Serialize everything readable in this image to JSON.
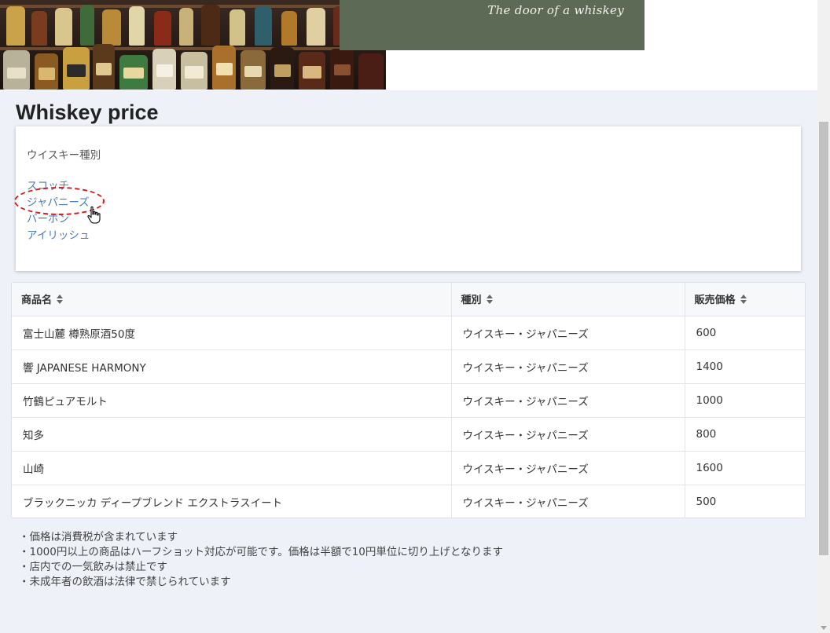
{
  "header": {
    "tagline": "The door of a whiskey"
  },
  "page_title": "Whiskey price",
  "category_card": {
    "label": "ウイスキー種別",
    "items": [
      {
        "label": "スコッチ"
      },
      {
        "label": "ジャパニーズ"
      },
      {
        "label": "バーボン"
      },
      {
        "label": "アイリッシュ"
      }
    ],
    "highlighted": "ジャパニーズ"
  },
  "table": {
    "headers": [
      "商品名",
      "種別",
      "販売価格"
    ],
    "rows": [
      {
        "name": "富士山麓 樽熟原酒50度",
        "type": "ウイスキー・ジャパニーズ",
        "price": "600"
      },
      {
        "name": "響 JAPANESE HARMONY",
        "type": "ウイスキー・ジャパニーズ",
        "price": "1400"
      },
      {
        "name": "竹鶴ピュアモルト",
        "type": "ウイスキー・ジャパニーズ",
        "price": "1000"
      },
      {
        "name": "知多",
        "type": "ウイスキー・ジャパニーズ",
        "price": "800"
      },
      {
        "name": "山崎",
        "type": "ウイスキー・ジャパニーズ",
        "price": "1600"
      },
      {
        "name": "ブラックニッカ ディープブレンド エクストラスイート",
        "type": "ウイスキー・ジャパニーズ",
        "price": "500"
      }
    ]
  },
  "notes": [
    "・価格は消費税が含まれています",
    "・1000円以上の商品はハーフショット対応が可能です。価格は半額で10円単位に切り上げとなります",
    "・店内での一気飲みは禁止です",
    "・未成年者の飲酒は法律で禁じられています"
  ],
  "colors": {
    "background": "#eef1f8",
    "tagline_box": "#5d6a55",
    "link": "#4a7ab8",
    "highlight": "#d11a1a"
  }
}
